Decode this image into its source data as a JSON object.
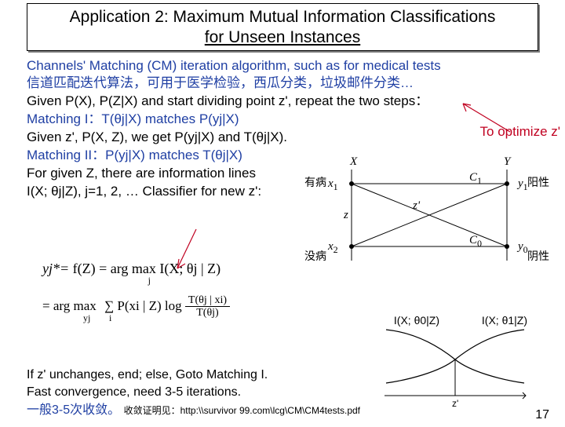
{
  "title": {
    "line1": "Application 2: Maximum Mutual Information Classifications",
    "line2": "for Unseen Instances"
  },
  "lines": {
    "cm": "Channels' Matching (CM) iteration algorithm, such as for medical tests",
    "cn_desc": "信道匹配迭代算法，可用于医学检验，西瓜分类，垃圾邮件分类…",
    "given1": "Given P(X), P(Z|X) and start dividing point z', repeat the two steps：",
    "match1": "Matching I：T(θj|X) matches P(yj|X)",
    "given2": "Given z', P(X, Z), we get P(yj|X) and T(θj|X).",
    "match2": "Matching II：P(yj|X) matches T(θj|X)",
    "forz": "For given Z, there are information lines",
    "classifier": "I(X; θj|Z), j=1, 2, … Classifier for new z':",
    "optimize": "To optimize z'"
  },
  "lattice": {
    "X": "X",
    "Y": "Y",
    "x1": "x1",
    "x2": "x2",
    "z": "z",
    "zprime": "z'",
    "C1": "C1",
    "C0": "C0",
    "y1": "y1",
    "y0": "y0",
    "have": "有病",
    "none": "没病",
    "pos": "阳性",
    "neg": "阴性"
  },
  "formula": {
    "ystar": "yj*=",
    "fZ": "f(Z) = arg max I(X; θj | Z)",
    "over_j": "j",
    "argmax": "= arg max",
    "over_yj": "yj",
    "sum": "∑ P(xi | Z) log",
    "over_i": "i",
    "frac_num": "T(θj | xi)",
    "frac_den": "T(θj)"
  },
  "info_lines": {
    "i0": "I(X; θ0|Z)",
    "i1": "I(X; θ1|Z)",
    "zprime": "z'"
  },
  "footer": {
    "if_end": "If z' unchanges, end; else, Goto Matching I.",
    "fast": "Fast convergence, need 3-5 iterations.",
    "cn": "一般3-5次收敛。",
    "proof": "收敛证明见：http:\\\\survivor 99.com\\lcg\\CM\\CM4tests.pdf"
  },
  "page": "17"
}
